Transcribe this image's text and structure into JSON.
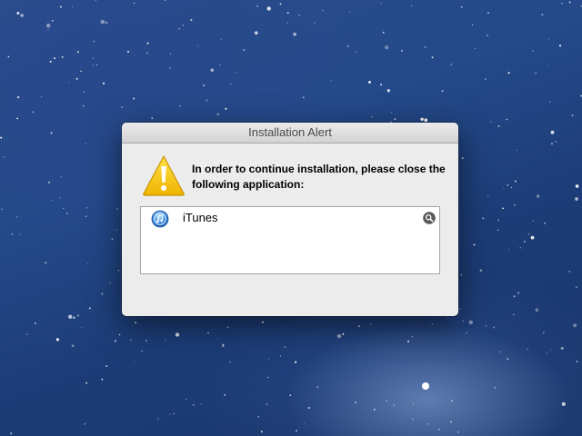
{
  "desktop": {
    "wallpaper": "starry-night-sky",
    "colors": {
      "sky_top": "#2b4d8c",
      "sky_bottom": "#1a3569"
    }
  },
  "dialog": {
    "title": "Installation Alert",
    "icon": "warning-triangle-icon",
    "message": "In order to continue installation, please close the following application:",
    "applications": [
      {
        "name": "iTunes",
        "icon": "itunes-icon",
        "action_icon": "magnifier-reveal-icon"
      }
    ],
    "colors": {
      "background": "#ececec",
      "warning_fill": "#f5c800",
      "itunes_blue": "#2f7fd6"
    }
  }
}
